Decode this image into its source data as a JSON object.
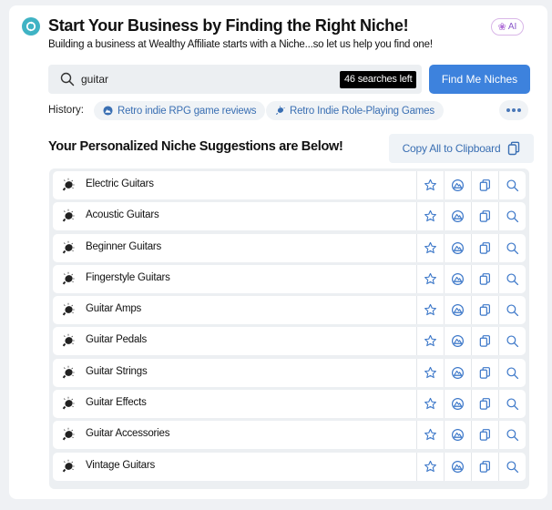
{
  "header": {
    "title": "Start Your Business by Finding the Right Niche!",
    "subtitle": "Building a business at Wealthy Affiliate starts with a Niche...so let us help you find one!",
    "logo_icon": "circular-arrows-icon",
    "ai_badge": {
      "icon": "brain-icon",
      "label": "AI"
    }
  },
  "search": {
    "icon": "search-icon",
    "value": "guitar",
    "placeholder": "",
    "searches_left": "46 searches left",
    "submit_label": "Find Me Niches"
  },
  "history": {
    "label": "History:",
    "items": [
      {
        "icon": "mountain-badge-icon",
        "label": "Retro indie RPG game reviews"
      },
      {
        "icon": "lightbulb-icon",
        "label": "Retro Indie Role-Playing Games"
      }
    ],
    "more_icon": "ellipsis-icon"
  },
  "results": {
    "title": "Your Personalized Niche Suggestions are Below!",
    "copy_all_label": "Copy All to Clipboard",
    "copy_all_icon": "copy-icon",
    "row_icon": "lightbulb-icon",
    "row_actions": [
      "star-icon",
      "mountain-badge-icon",
      "copy-icon",
      "search-icon"
    ],
    "items": [
      "Electric Guitars",
      "Acoustic Guitars",
      "Beginner Guitars",
      "Fingerstyle Guitars",
      "Guitar Amps",
      "Guitar Pedals",
      "Guitar Strings",
      "Guitar Effects",
      "Guitar Accessories",
      "Vintage Guitars"
    ]
  },
  "colors": {
    "accent": "#3d82dd",
    "link": "#3a6fb3",
    "logo": "#3fb3c4",
    "page_bg": "#eff1f4",
    "chip_bg": "#f0f3f6"
  }
}
